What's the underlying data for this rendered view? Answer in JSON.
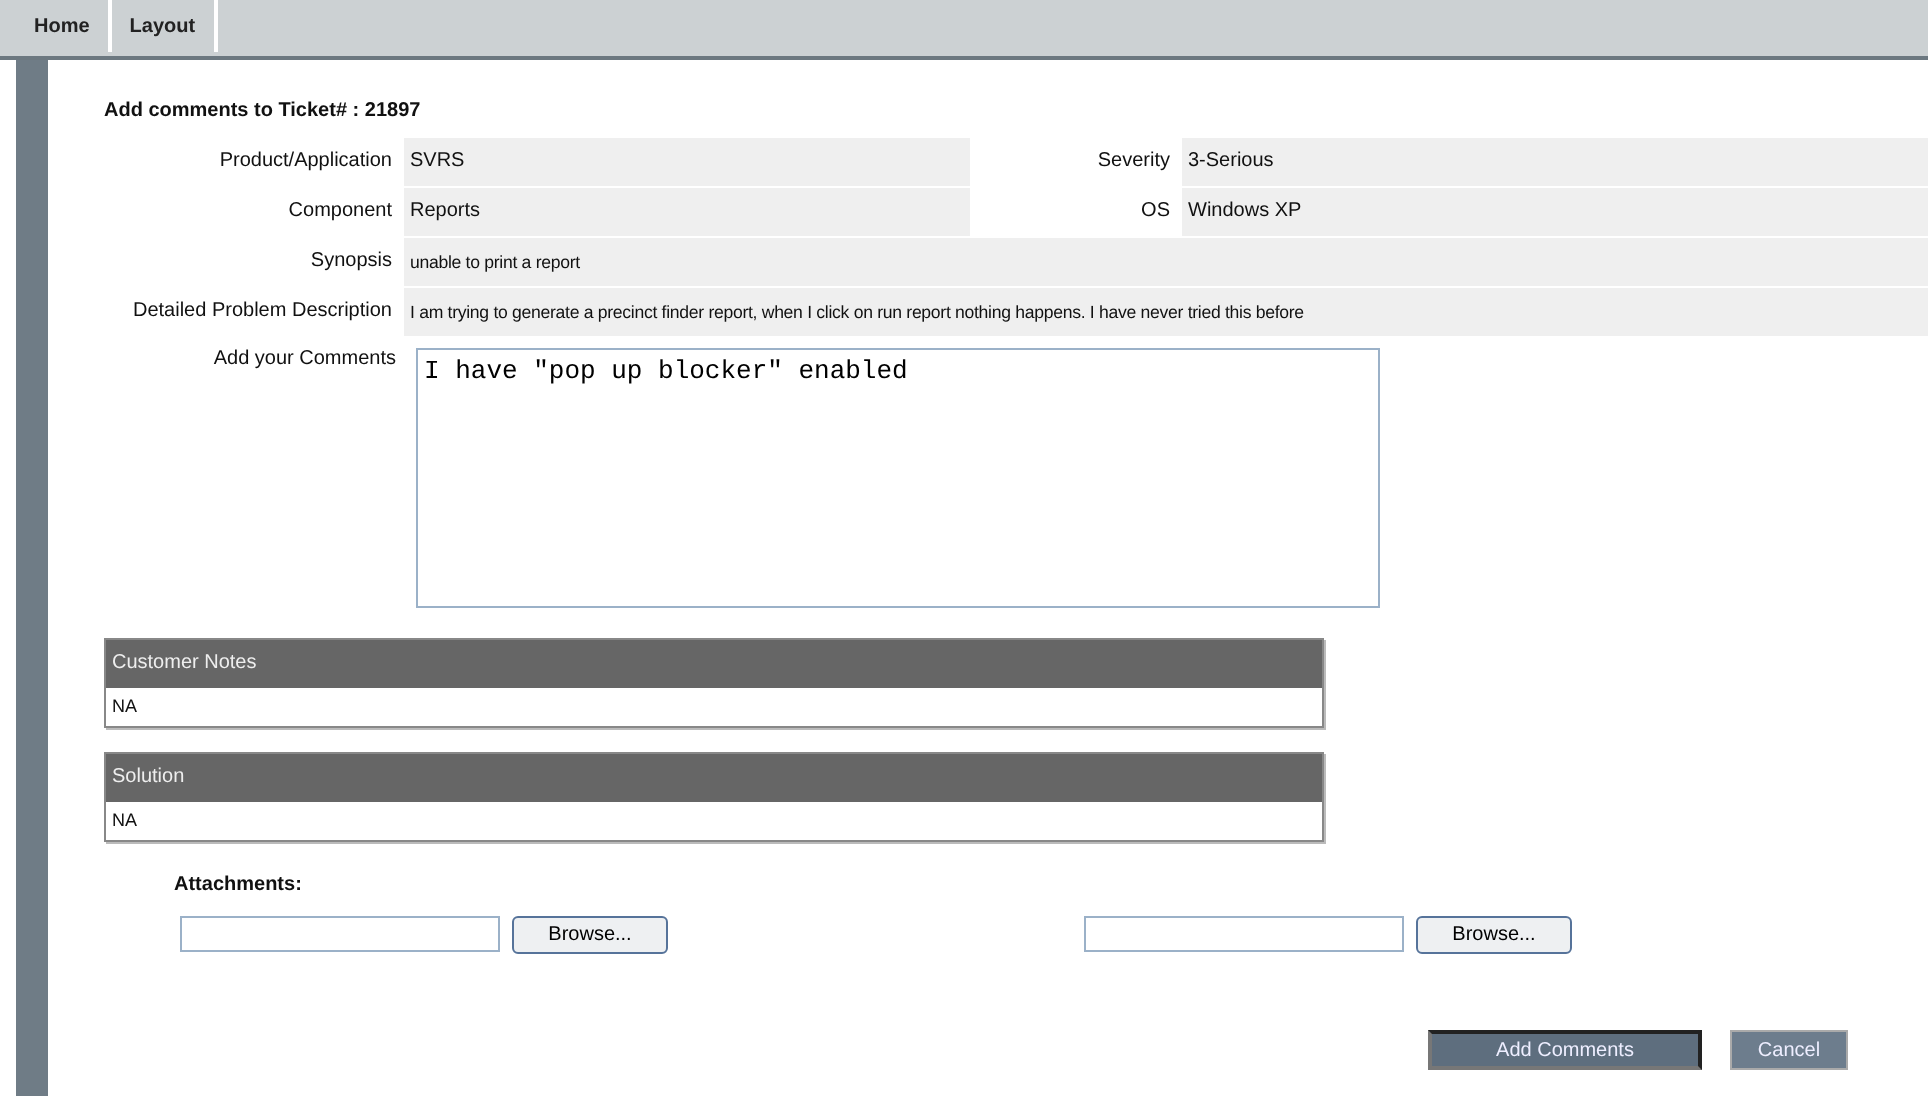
{
  "tabs": [
    {
      "label": "Home"
    },
    {
      "label": "Layout"
    }
  ],
  "title": "Add comments to Ticket# : 21897",
  "fields": [
    {
      "kind": "pair",
      "label": "Product/Application",
      "value": "SVRS",
      "label_2": "Severity",
      "value_2": "3-Serious"
    },
    {
      "kind": "pair",
      "label": "Component",
      "value": "Reports",
      "label_2": "OS",
      "value_2": "Windows XP"
    },
    {
      "kind": "single",
      "label": "Synopsis",
      "value": "unable to print a report"
    },
    {
      "kind": "single",
      "label": "Detailed Problem Description",
      "value": "I am trying to generate a precinct finder report, when I click on run report nothing happens. I have never tried this before"
    }
  ],
  "comments": {
    "label": "Add your Comments",
    "value": "I have \"pop up blocker\" enabled"
  },
  "panels": [
    {
      "title": "Customer Notes",
      "body": "NA"
    },
    {
      "title": "Solution",
      "body": "NA"
    }
  ],
  "attachments": {
    "label": "Attachments:",
    "browse": [
      "Browse...",
      "Browse..."
    ]
  },
  "buttons": [
    {
      "kind": "primary",
      "label": "Add Comments"
    },
    {
      "kind": "secondary",
      "label": "Cancel"
    }
  ]
}
